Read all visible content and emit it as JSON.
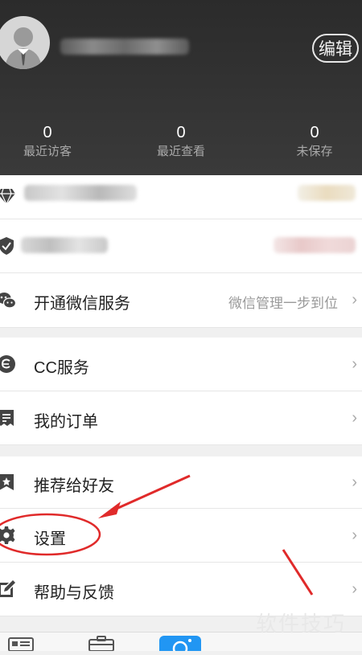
{
  "header": {
    "edit_label": "编辑"
  },
  "stats": [
    {
      "value": "0",
      "label": "最近访客"
    },
    {
      "value": "0",
      "label": "最近查看"
    },
    {
      "value": "0",
      "label": "未保存"
    }
  ],
  "menu": {
    "wechat_label": "开通微信服务",
    "wechat_hint": "微信管理一步到位",
    "cc_label": "CC服务",
    "orders_label": "我的订单",
    "recommend_label": "推荐给好友",
    "settings_label": "设置",
    "help_label": "帮助与反馈"
  },
  "watermark": "软件技巧",
  "icons": [
    "diamond-icon",
    "shield-check-icon",
    "wechat-icon",
    "cc-icon",
    "order-icon",
    "star-bookmark-icon",
    "gear-icon",
    "edit-pencil-icon",
    "contacts-tab-icon",
    "briefcase-tab-icon",
    "camera-tab-icon"
  ],
  "colors": {
    "header_bg": "#2b2b2b",
    "annotation_red": "#e02a2a",
    "tab_active": "#2196f3"
  }
}
